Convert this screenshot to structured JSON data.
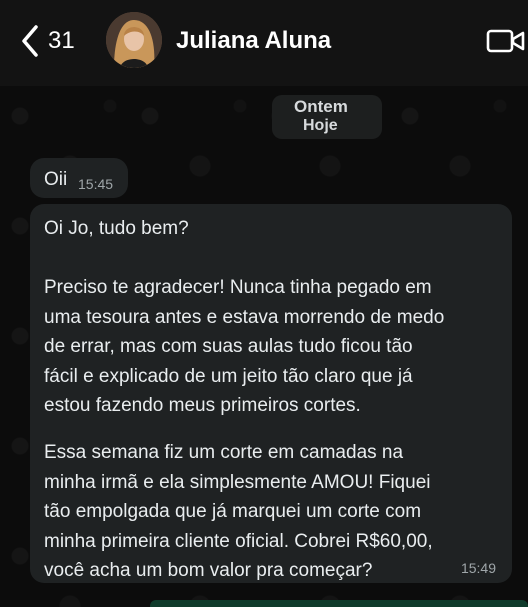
{
  "header": {
    "back_count": "31",
    "contact_name": "Juliana Aluna"
  },
  "chat": {
    "date_old": "Ontem",
    "date_today": "Hoje",
    "messages": [
      {
        "text": "Oii",
        "time": "15:45"
      },
      {
        "paragraphs": [
          "Oi Jo, tudo bem?",
          "Preciso te agradecer! Nunca tinha pegado em\numa tesoura antes e estava morrendo de medo\nde errar, mas com suas aulas tudo ficou tão\nfácil e explicado de um jeito tão claro que já\nestou fazendo meus primeiros cortes.",
          "Essa semana fiz um corte em camadas na\nminha irmã e ela simplesmente AMOU! Fiquei\ntão empolgada que já marquei um corte com\nminha primeira cliente oficial. Cobrei R$60,00,\nvocê acha um bom valor pra começar?"
        ],
        "time": "15:49"
      }
    ]
  }
}
